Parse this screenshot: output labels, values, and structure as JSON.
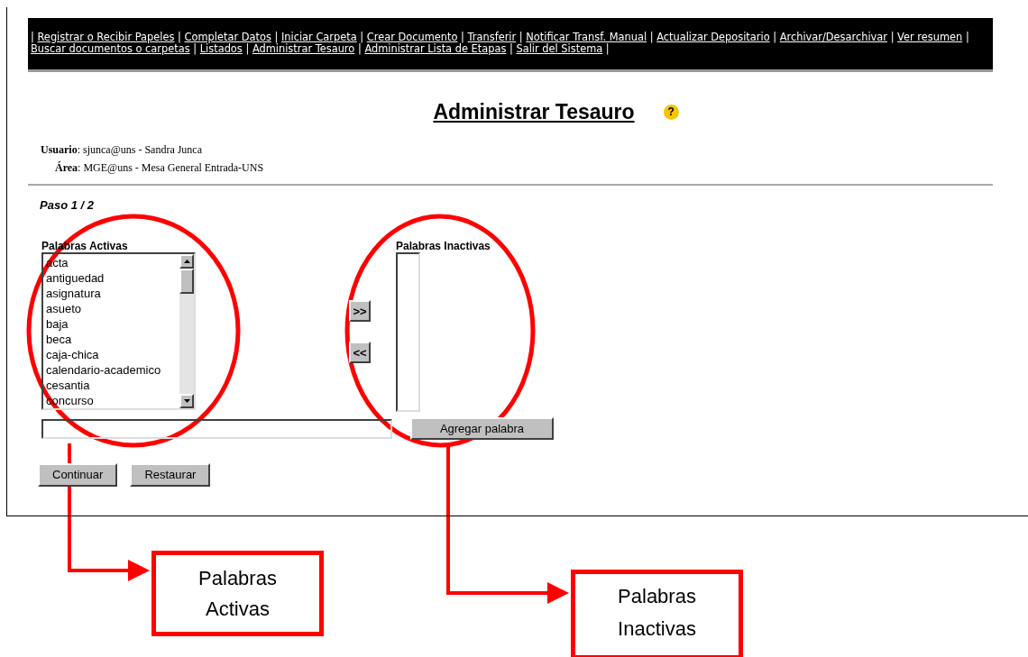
{
  "nav": {
    "separator": "|",
    "links": [
      "Registrar o Recibir Papeles",
      "Completar Datos",
      "Iniciar Carpeta",
      "Crear Documento",
      "Transferir",
      "Notificar Transf. Manual",
      "Actualizar Depositario",
      "Archivar/Desarchivar",
      "Ver resumen",
      "Buscar documentos o carpetas",
      "Listados",
      "Administrar Tesauro",
      "Administrar Lista de Etapas",
      "Salir del Sistema"
    ]
  },
  "title": "Administrar Tesauro",
  "help": "?",
  "user": "**Usuario**: sjunca@uns - Sandra Junca",
  "area": "**Área**: MGE@uns - Mesa General Entrada-UNS",
  "step": "Paso 1 / 2",
  "active_words": {
    "label": "Palabras Activas",
    "items": [
      "acta",
      "antiguedad",
      "asignatura",
      "asueto",
      "baja",
      "beca",
      "caja-chica",
      "calendario-academico",
      "cesantia",
      "concurso"
    ]
  },
  "move_buttons": [
    ">>",
    "<<"
  ],
  "inactive_words": {
    "label": "Palabras Inactivas"
  },
  "new_word": {
    "button": "Agregar palabra"
  },
  "buttons": [
    "Continuar",
    "Restaurar"
  ],
  "annotations": [
    {
      "text": "Palabras Activas"
    },
    {
      "text": "Palabras Inactivas"
    }
  ]
}
